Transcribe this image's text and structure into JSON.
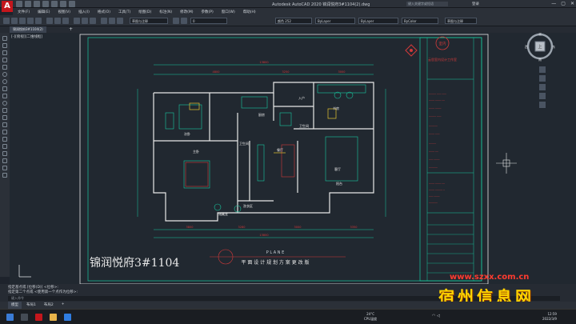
{
  "app": {
    "logo": "A",
    "window_title": "Autodesk AutoCAD 2020   锦润悦府3#1104(2).dwg",
    "search_placeholder": "键入关键字或短语",
    "user": "登录",
    "controls": [
      "—",
      "▢",
      "✕"
    ]
  },
  "menu": [
    "文件(F)",
    "编辑(E)",
    "视图(V)",
    "插入(I)",
    "格式(O)",
    "工具(T)",
    "绘图(D)",
    "标注(N)",
    "修改(M)",
    "参数(P)",
    "窗口(W)",
    "帮助(H)"
  ],
  "toolbar": {
    "workspace": "草图与注释",
    "layer": "0",
    "color": "颜色 252",
    "linetype": "ByLayer",
    "lineweight": "ByLayer",
    "plotstyle": "ByColor",
    "workspace2": "草图与注释"
  },
  "tabs": {
    "doc_tab": "锦润悦府3#1104(2)",
    "add": "+"
  },
  "viewport": {
    "label": "[-][俯视][二维线框]"
  },
  "viewcube": {
    "north": "北",
    "south": "南",
    "east": "东",
    "west": "西",
    "top": "上"
  },
  "drawing": {
    "title": "锦润悦府3#1104",
    "subtitle": "平 面 设 计 规 划 方 案 更 改 版",
    "plane": "P L A N E",
    "studio": "云思室内设计工作室",
    "stamp": "室内",
    "dims_top": [
      "13800",
      "4800",
      "3250",
      "3000"
    ],
    "dims_bottom": [
      "3800",
      "3280",
      "3000",
      "3350",
      "13800"
    ],
    "rooms": {
      "bedroom2": "次卧",
      "kitchen": "厨房",
      "study": "书房",
      "master": "主卧",
      "toilet": "卫生间",
      "dining": "餐厅",
      "living": "客厅",
      "balcony": "阳台",
      "entry": "入户",
      "laundry": "洗衣区",
      "bath": "卫生间",
      "storage": "储藏室"
    }
  },
  "command": {
    "line1": "指定基点或 [位移(D)] <位移>:",
    "line2": "指定第二个点或 <使用第一个点作为位移>:",
    "input_placeholder": "键入命令"
  },
  "layouts": [
    "模型",
    "布局1",
    "布局2",
    "+"
  ],
  "taskbar": {
    "weather_temp": "24°C",
    "weather_desc": "CPU温度",
    "clock_time": "12:59",
    "clock_date": "2022/3/9"
  },
  "watermark": {
    "site": "www.szxx.com.cn",
    "name": "宿州信息网"
  }
}
